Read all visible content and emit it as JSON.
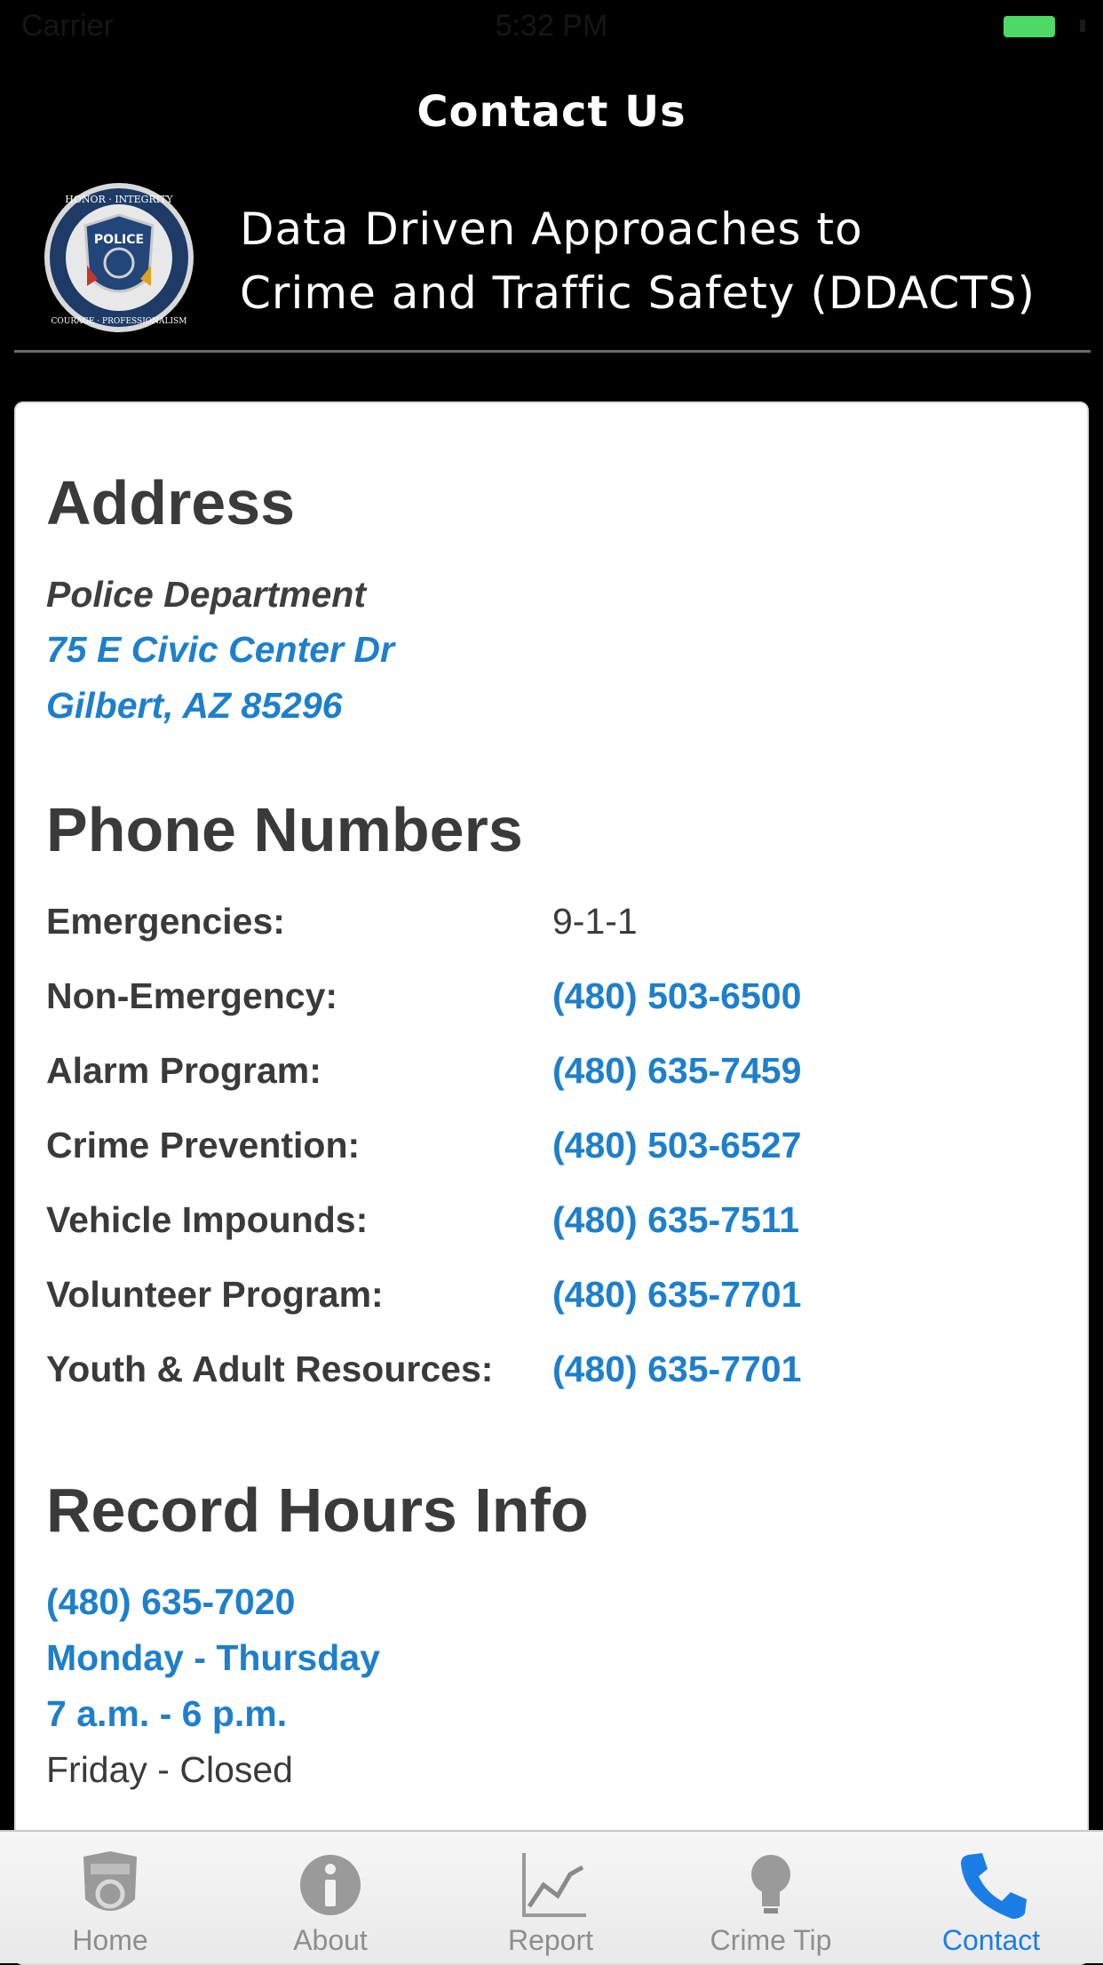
{
  "status_bar": {
    "carrier": "Carrier",
    "time": "5:32 PM"
  },
  "nav": {
    "title": "Contact Us"
  },
  "header": {
    "title_line1": "Data Driven Approaches to",
    "title_line2": "Crime and Traffic Safety (DDACTS)",
    "badge_text": {
      "top": "HONOR · INTEGRITY",
      "bottom": "COURAGE · PROFESSIONALISM",
      "center": "POLICE"
    }
  },
  "address": {
    "heading": "Address",
    "department": "Police Department",
    "street": "75 E Civic Center Dr",
    "city": "Gilbert, AZ 85296"
  },
  "phones": {
    "heading": "Phone Numbers",
    "rows": [
      {
        "label": "Emergencies:",
        "value": "9-1-1"
      },
      {
        "label": "Non-Emergency:",
        "value": "(480) 503-6500"
      },
      {
        "label": "Alarm Program:",
        "value": "(480) 635-7459"
      },
      {
        "label": "Crime Prevention:",
        "value": "(480) 503-6527"
      },
      {
        "label": "Vehicle Impounds:",
        "value": "(480) 635-7511"
      },
      {
        "label": "Volunteer Program:",
        "value": "(480) 635-7701"
      },
      {
        "label": "Youth & Adult Resources:",
        "value": "(480) 635-7701"
      }
    ]
  },
  "records": {
    "heading": "Record Hours Info",
    "phone": "(480) 635-7020",
    "days": "Monday - Thursday",
    "hours": "7 a.m. - 6 p.m.",
    "friday": "Friday - Closed"
  },
  "tabs": [
    {
      "label": "Home",
      "icon": "police-badge-icon"
    },
    {
      "label": "About",
      "icon": "info-icon"
    },
    {
      "label": "Report",
      "icon": "chart-icon"
    },
    {
      "label": "Crime Tip",
      "icon": "lightbulb-icon"
    },
    {
      "label": "Contact",
      "icon": "phone-icon",
      "active": true
    }
  ],
  "colors": {
    "accent": "#1e7fcb",
    "tab_active": "#1a7ee6",
    "battery": "#4cd964"
  }
}
